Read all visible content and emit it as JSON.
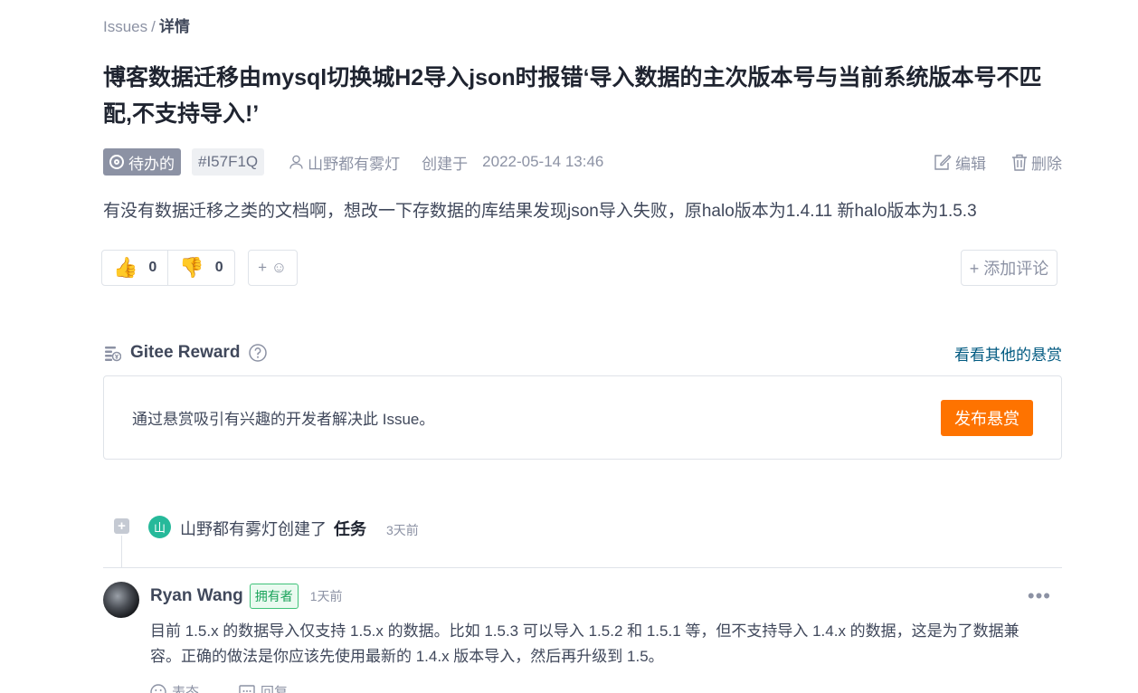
{
  "breadcrumb": {
    "parent": "Issues",
    "separator": "/",
    "current": "详情"
  },
  "issue": {
    "title": "博客数据迁移由mysql切换城H2导入json时报错‘导入数据的主次版本号与当前系统版本号不匹配,不支持导入!’",
    "status": "待办的",
    "id": "#I57F1Q",
    "author": "山野都有雾灯",
    "created_label": "创建于",
    "created_time": "2022-05-14 13:46",
    "edit_label": "编辑",
    "delete_label": "删除",
    "description": "有没有数据迁移之类的文档啊，想改一下存数据的库结果发现json导入失败，原halo版本为1.4.11 新halo版本为1.5.3"
  },
  "reactions": {
    "thumbs_up_emoji": "👍",
    "thumbs_up_count": "0",
    "thumbs_down_emoji": "👎",
    "thumbs_down_count": "0",
    "add_emoji_label": "+ ☺",
    "add_comment_label": "+ 添加评论"
  },
  "reward": {
    "title": "Gitee Reward",
    "more_link": "看看其他的悬赏",
    "text": "通过悬赏吸引有兴趣的开发者解决此 Issue。",
    "button": "发布悬赏"
  },
  "timeline": {
    "avatar_char": "山",
    "text": "山野都有雾灯创建了",
    "type": "任务",
    "ago": "3天前"
  },
  "comment": {
    "author": "Ryan Wang",
    "badge": "拥有者",
    "ago": "1天前",
    "more": "•••",
    "body": "目前 1.5.x 的数据导入仅支持 1.5.x 的数据。比如 1.5.3 可以导入 1.5.2 和 1.5.1 等，但不支持导入 1.4.x 的数据，这是为了数据兼容。正确的做法是你应该先使用最新的 1.4.x 版本导入，然后再升级到 1.5。",
    "react_label": "表态",
    "reply_label": "回复"
  },
  "colors": {
    "accent_orange": "#fe7300",
    "link_blue": "#005980",
    "status_gray": "#8c92a4",
    "owner_green": "#1aa35a"
  }
}
